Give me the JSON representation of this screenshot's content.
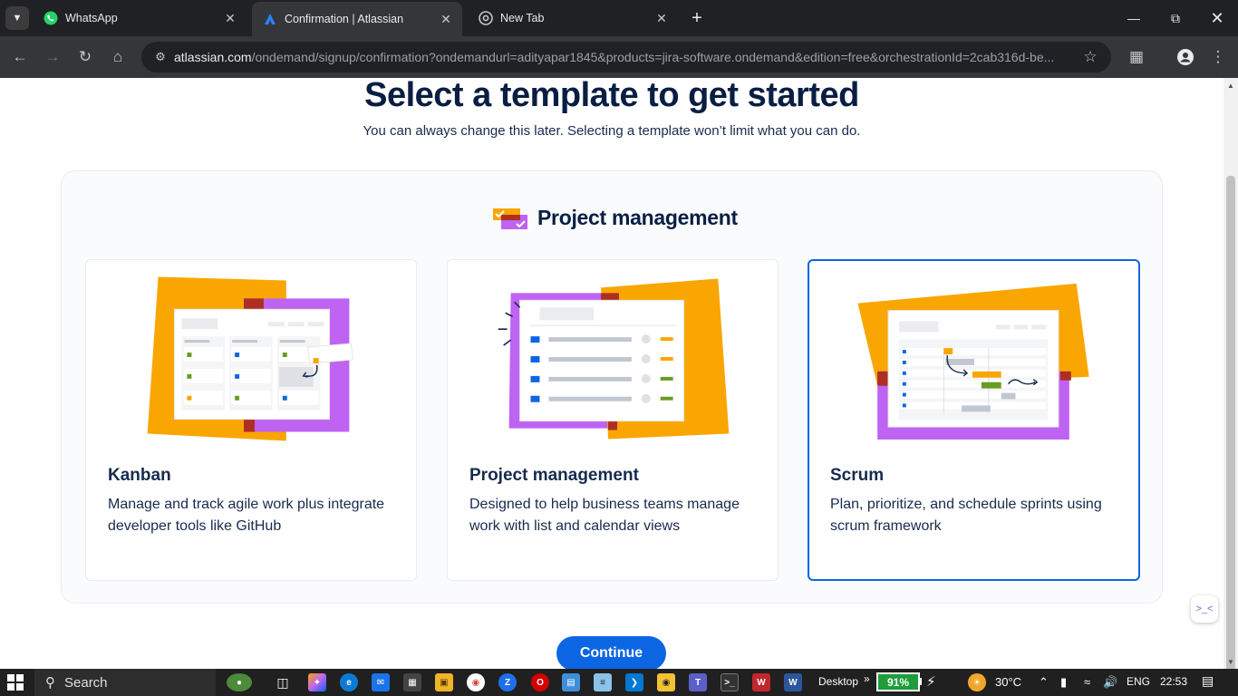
{
  "browser": {
    "tabs": [
      {
        "title": "WhatsApp",
        "icon": "whatsapp-icon",
        "active": false
      },
      {
        "title": "Confirmation | Atlassian",
        "icon": "atlassian-icon",
        "active": true
      },
      {
        "title": "New Tab",
        "icon": "chrome-icon",
        "active": false
      }
    ],
    "url_host": "atlassian.com",
    "url_rest": "/ondemand/signup/confirmation?ondemandurl=adityapar1845&products=jira-software.ondemand&edition=free&orchestrationId=2cab316d-be..."
  },
  "page": {
    "title": "Select a template to get started",
    "subtitle": "You can always change this later. Selecting a template won’t limit what you can do.",
    "section_title": "Project management",
    "templates": [
      {
        "title": "Kanban",
        "description": "Manage and track agile work plus integrate developer tools like GitHub",
        "selected": false
      },
      {
        "title": "Project management",
        "description": "Designed to help business teams manage work with list and calendar views",
        "selected": false
      },
      {
        "title": "Scrum",
        "description": "Plan, prioritize, and schedule sprints using scrum framework",
        "selected": true
      }
    ],
    "continue_label": "Continue",
    "colors": {
      "accent": "#0c66e4",
      "orange": "#f9a602",
      "purple": "#bf63f3",
      "dark_red": "#ae2e24"
    }
  },
  "taskbar": {
    "search_label": "Search",
    "desktop_label": "Desktop",
    "battery": "91%",
    "weather": "30°C",
    "language": "ENG",
    "time": "22:53"
  }
}
